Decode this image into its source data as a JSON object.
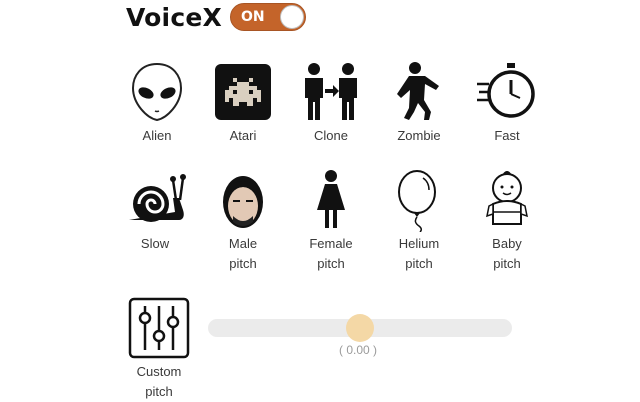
{
  "app": {
    "title": "VoiceX",
    "toggle_label": "ON",
    "toggle_on": true,
    "accent_color": "#c4642a"
  },
  "effects": [
    {
      "label": "Alien",
      "icon": "alien-icon"
    },
    {
      "label": "Atari",
      "icon": "space-invader-icon"
    },
    {
      "label": "Clone",
      "icon": "clone-people-icon"
    },
    {
      "label": "Zombie",
      "icon": "zombie-icon"
    },
    {
      "label": "Fast",
      "icon": "stopwatch-icon"
    },
    {
      "label": "Slow",
      "icon": "snail-icon"
    },
    {
      "label": "Male\npitch",
      "icon": "male-face-icon"
    },
    {
      "label": "Female\npitch",
      "icon": "female-figure-icon"
    },
    {
      "label": "Helium\npitch",
      "icon": "balloon-icon"
    },
    {
      "label": "Baby\npitch",
      "icon": "baby-icon"
    },
    {
      "label": "Custom\npitch",
      "icon": "equalizer-sliders-icon"
    }
  ],
  "custom_pitch": {
    "value_text": "( 0.00 )",
    "value": 0.5,
    "thumb_color": "#f4d8a6"
  }
}
